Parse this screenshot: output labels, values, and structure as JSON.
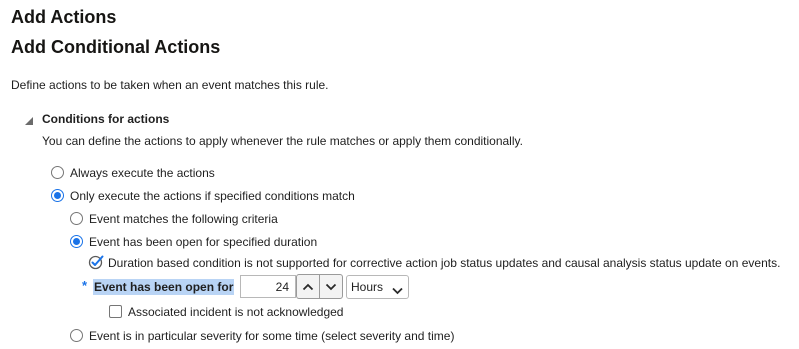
{
  "page": {
    "title": "Add Actions",
    "subtitle": "Add Conditional Actions",
    "description": "Define actions to be taken when an event matches this rule."
  },
  "conditions": {
    "heading": "Conditions for actions",
    "help": "You can define the actions to apply whenever the rule matches or apply them conditionally.",
    "always_label": "Always execute the actions",
    "only_label": "Only execute the actions if specified conditions match",
    "criteria_label": "Event matches the following criteria",
    "duration_label": "Event has been open for specified duration",
    "info_message": "Duration based condition is not supported for corrective action job status updates and causal analysis status update on events.",
    "required_mark": "*",
    "open_for_label": "Event has been open for",
    "open_for_value": "24",
    "unit_selected": "Hours",
    "not_ack_label": "Associated incident is not acknowledged",
    "severity_label": "Event is in particular severity for some time (select severity and time)"
  },
  "colors": {
    "accent": "#1a73e8",
    "required": "#1a73e8"
  }
}
